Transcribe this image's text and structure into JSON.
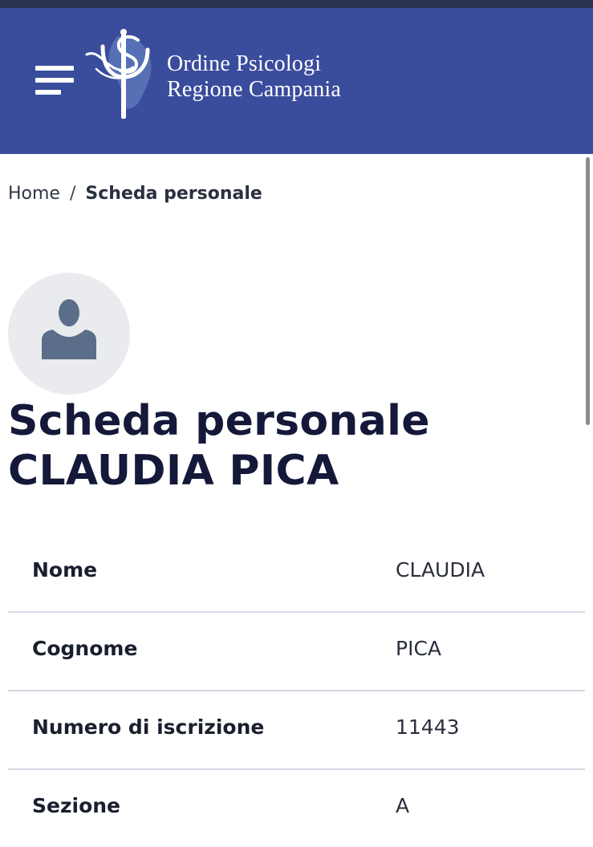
{
  "header": {
    "org_name_line1": "Ordine Psicologi",
    "org_name_line2": "Regione Campania",
    "menu_icon": "hamburger-menu-icon",
    "logo_icon": "psi-symbol-logo",
    "background_color": "#3a4c9c"
  },
  "breadcrumb": {
    "home": "Home",
    "separator": "/",
    "current": "Scheda personale"
  },
  "profile": {
    "avatar_icon": "user-placeholder-icon",
    "title_line1": "Scheda personale",
    "title_line2": "CLAUDIA PICA"
  },
  "details": [
    {
      "label": "Nome",
      "value": "CLAUDIA"
    },
    {
      "label": "Cognome",
      "value": "PICA"
    },
    {
      "label": "Numero di iscrizione",
      "value": "11443"
    },
    {
      "label": "Sezione",
      "value": "A"
    }
  ]
}
